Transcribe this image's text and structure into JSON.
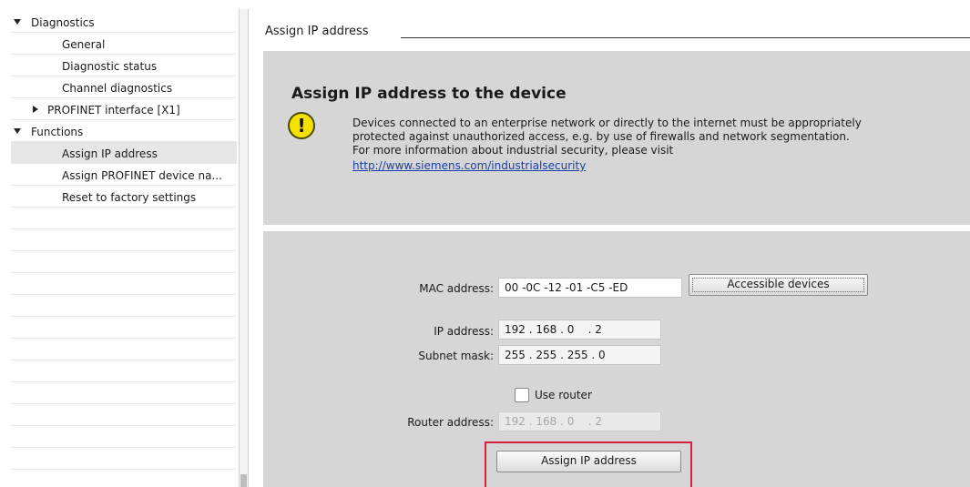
{
  "tree": {
    "items": [
      {
        "label": "Diagnostics",
        "expander": "chevron-down-icon"
      },
      {
        "label": "General"
      },
      {
        "label": "Diagnostic status"
      },
      {
        "label": "Channel diagnostics"
      },
      {
        "label": "PROFINET interface [X1]",
        "expander": "chevron-right-icon"
      },
      {
        "label": "Functions",
        "expander": "chevron-down-icon"
      },
      {
        "label": "Assign IP address"
      },
      {
        "label": "Assign PROFINET device na..."
      },
      {
        "label": "Reset to factory settings"
      }
    ]
  },
  "section": {
    "title": "Assign IP address"
  },
  "info": {
    "title": "Assign IP address to the device",
    "icon": "warning-icon",
    "icon_glyph": "!",
    "lines": [
      "Devices connected to an enterprise network or directly to the internet must be appropriately",
      "protected against unauthorized access, e.g. by use of firewalls and network segmentation.",
      "For more information about industrial security, please visit"
    ],
    "link": "http://www.siemens.com/industrialsecurity"
  },
  "form": {
    "mac_label": "MAC address:",
    "mac_value": "00 -0C -12 -01 -C5 -ED",
    "accessible_devices_label": "Accessible devices",
    "ip_label": "IP address:",
    "ip_value": "192 . 168 . 0    . 2",
    "subnet_label": "Subnet mask:",
    "subnet_value": "255 . 255 . 255 . 0",
    "use_router_label": "Use router",
    "use_router_checked": false,
    "router_label": "Router address:",
    "router_value": "192 . 168 . 0    . 2",
    "assign_button_label": "Assign IP address"
  },
  "colors": {
    "panel": "#d6d6d6",
    "highlight": "#d4213d",
    "link": "#1a3ea8",
    "warning": "#f5e100"
  }
}
